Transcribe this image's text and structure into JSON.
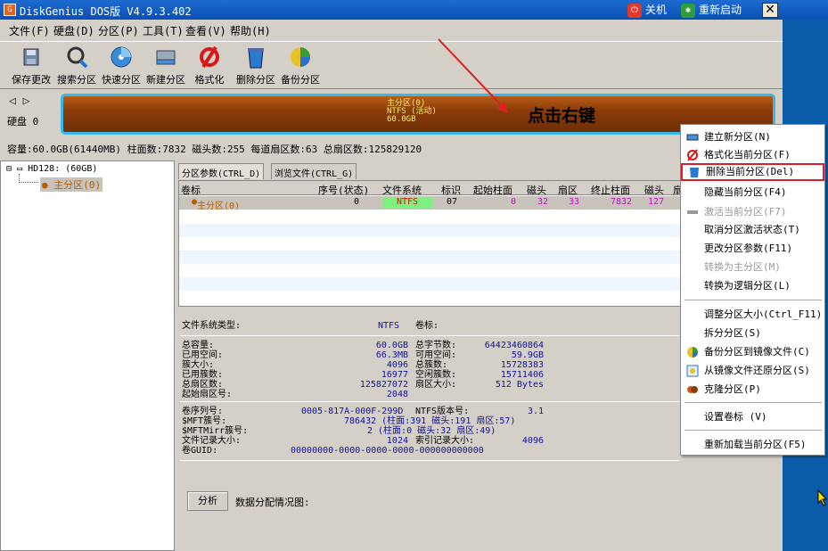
{
  "window": {
    "title": "DiskGenius DOS版 V4.9.3.402",
    "shutdown_label": "关机",
    "restart_label": "重新启动"
  },
  "menu": [
    "文件(F)",
    "硬盘(D)",
    "分区(P)",
    "工具(T)",
    "查看(V)",
    "帮助(H)"
  ],
  "toolbar": [
    "保存更改",
    "搜索分区",
    "快速分区",
    "新建分区",
    "格式化",
    "删除分区",
    "备份分区"
  ],
  "disk": {
    "nav": "◁ ▷",
    "label": "硬盘 0",
    "partition_bar": {
      "line1": "主分区(0)",
      "line2": "NTFS (活动)",
      "line3": "60.0GB"
    },
    "info": "容量:60.0GB(61440MB)  柱面数:7832  磁头数:255  每道扇区数:63  总扇区数:125829120"
  },
  "annotation": "点击右键",
  "tree": {
    "disk_node": "HD128: (60GB)",
    "partition_node": "主分区(0)"
  },
  "tabs": [
    "分区参数(CTRL_D)",
    "浏览文件(CTRL_G)"
  ],
  "grid": {
    "headers": [
      "卷标",
      "序号(状态)",
      "文件系统",
      "标识",
      "起始柱面",
      "磁头",
      "扇区",
      "终止柱面",
      "磁头",
      "扇"
    ],
    "row": {
      "label": "主分区(0)",
      "index": "0",
      "fs": "NTFS",
      "id": "07",
      "start_cyl": "0",
      "start_head": "32",
      "start_sec": "33",
      "end_cyl": "7832",
      "end_head": "127"
    }
  },
  "details": {
    "fs_type_label": "文件系统类型:",
    "fs_type": "NTFS",
    "vol_label": "卷标:",
    "left": [
      {
        "k": "总容量:",
        "v": "60.0GB"
      },
      {
        "k": "已用空间:",
        "v": "66.3MB"
      },
      {
        "k": "簇大小:",
        "v": "4096"
      },
      {
        "k": "已用簇数:",
        "v": "16977"
      },
      {
        "k": "总扇区数:",
        "v": "125827072"
      },
      {
        "k": "起始扇区号:",
        "v": "2048"
      }
    ],
    "right": [
      {
        "k": "总字节数:",
        "v": "64423460864"
      },
      {
        "k": "可用空间:",
        "v": "59.9GB"
      },
      {
        "k": "总簇数:",
        "v": "15728383"
      },
      {
        "k": "空闲簇数:",
        "v": "15711406"
      },
      {
        "k": "扇区大小:",
        "v": "512 Bytes"
      }
    ],
    "serial_label": "卷序列号:",
    "serial": "0005-817A-000F-299D",
    "ntfs_ver_label": "NTFS版本号:",
    "ntfs_ver": "3.1",
    "mft_label": "$MFT簇号:",
    "mft": "786432 (柱面:391 磁头:191 扇区:57)",
    "mftmirr_label": "$MFTMirr簇号:",
    "mftmirr": "2 (柱面:0 磁头:32 扇区:49)",
    "record_label": "文件记录大小:",
    "record": "1024",
    "index_label": "索引记录大小:",
    "index": "4096",
    "guid_label": "卷GUID:",
    "guid": "00000000-0000-0000-0000-000000000000",
    "analyze_button": "分析",
    "alloc_label": "数据分配情况图:"
  },
  "context_menu": [
    {
      "label": "建立新分区(N)",
      "disabled": false
    },
    {
      "label": "格式化当前分区(F)",
      "disabled": false
    },
    {
      "label": "删除当前分区(Del)",
      "disabled": false,
      "highlight": true
    },
    {
      "label": "隐藏当前分区(F4)",
      "disabled": false
    },
    {
      "label": "激活当前分区(F7)",
      "disabled": true
    },
    {
      "label": "取消分区激活状态(T)",
      "disabled": false
    },
    {
      "label": "更改分区参数(F11)",
      "disabled": false
    },
    {
      "label": "转换为主分区(M)",
      "disabled": true
    },
    {
      "label": "转换为逻辑分区(L)",
      "disabled": false
    },
    {
      "label": "调整分区大小(Ctrl_F11)",
      "disabled": false
    },
    {
      "label": "拆分分区(S)",
      "disabled": false
    },
    {
      "label": "备份分区到镜像文件(C)",
      "disabled": false
    },
    {
      "label": "从镜像文件还原分区(S)",
      "disabled": false
    },
    {
      "label": "克隆分区(P)",
      "disabled": false
    },
    {
      "label": "设置卷标 (V)",
      "disabled": false
    },
    {
      "label": "重新加载当前分区(F5)",
      "disabled": false
    }
  ],
  "colors": {
    "partition_bar": "#8a3c08",
    "highlight_border": "#d8202a",
    "desktop": "#0a5ca8"
  }
}
